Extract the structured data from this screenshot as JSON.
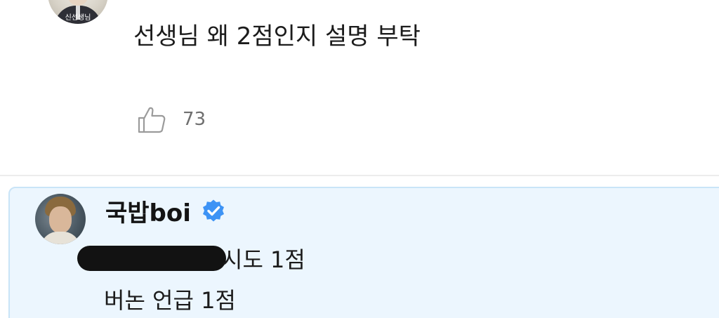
{
  "top_comment": {
    "avatar_caption": "신선생님",
    "text": "선생님 왜 2점인지 설명 부탁",
    "likes": "73",
    "like_icon": "thumbs-up-icon"
  },
  "reply": {
    "author": "국밥boi",
    "verified_icon": "verified-badge-icon",
    "line1_suffix": "시도 1점",
    "line2": "버논 언급 1점"
  },
  "colors": {
    "reply_background": "#ecf6fe",
    "reply_border": "#c9e4f7",
    "verified_blue": "#3d93f5",
    "like_count": "#6f6f6f"
  }
}
